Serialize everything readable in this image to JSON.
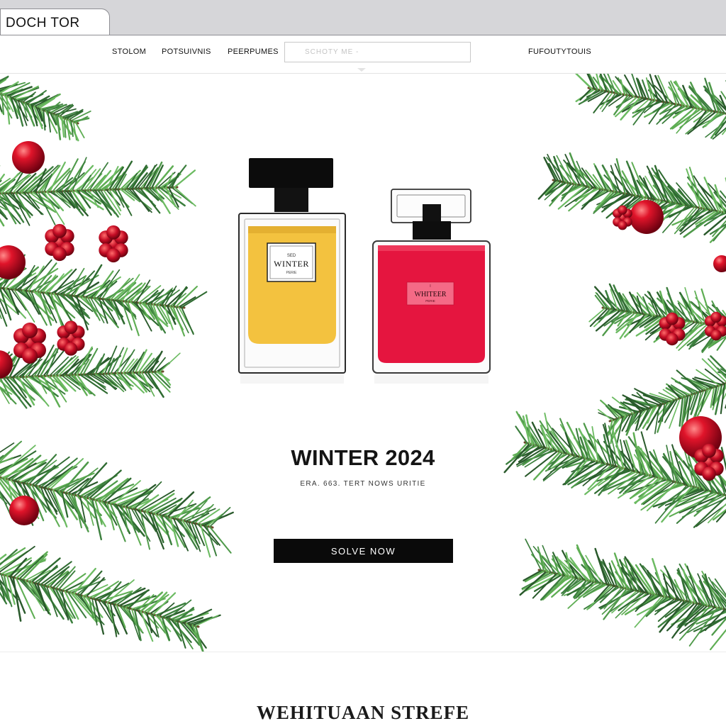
{
  "browser": {
    "tab_title": "DOCH TOR"
  },
  "nav": {
    "links": [
      "STOLOM",
      "POTSUIVNIS",
      "PEERPUMES"
    ],
    "search_placeholder": "SCHOTY ME -",
    "right_link": "FUFOUTYTOUIS"
  },
  "hero": {
    "products": [
      {
        "label_small": "SED",
        "label_main": "WINTER",
        "label_sub": "PERIE",
        "liquid_color": "#f3c23f"
      },
      {
        "label_small": "I",
        "label_main": "WHITEER",
        "label_sub": "PERIE",
        "liquid_color": "#e5153f"
      }
    ],
    "title": "WINTER 2024",
    "subtitle": "ERA. 663. TERT NOWS URITIE",
    "cta_label": "SOLVE NOW"
  },
  "footer": {
    "title": "WEHITUAAN STREFE"
  },
  "colors": {
    "accent": "#0a0a0a",
    "pine": "#3c7f3e",
    "ornament": "#c8102e"
  }
}
